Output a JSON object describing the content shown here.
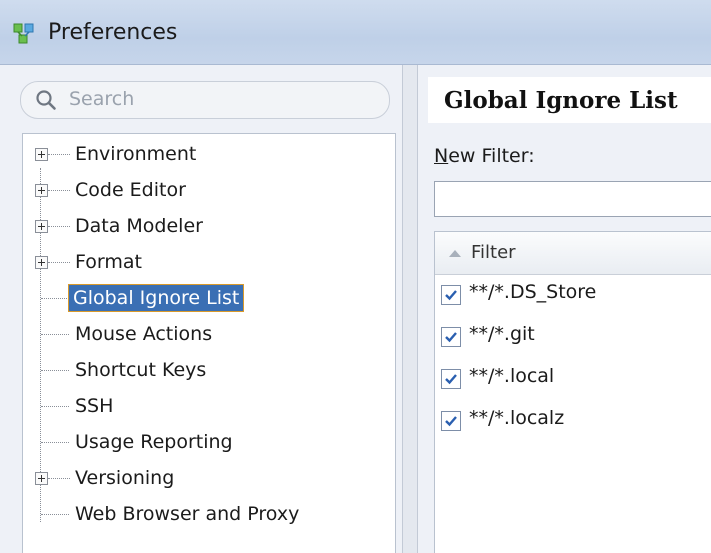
{
  "window": {
    "title": "Preferences",
    "icon": "preferences-app-icon"
  },
  "left_panel": {
    "search": {
      "placeholder": "Search",
      "value": ""
    },
    "tree": [
      {
        "label": "Environment",
        "expandable": true
      },
      {
        "label": "Code Editor",
        "expandable": true
      },
      {
        "label": "Data Modeler",
        "expandable": true
      },
      {
        "label": "Format",
        "expandable": true
      },
      {
        "label": "Global Ignore List",
        "expandable": false,
        "selected": true
      },
      {
        "label": "Mouse Actions",
        "expandable": false
      },
      {
        "label": "Shortcut Keys",
        "expandable": false
      },
      {
        "label": "SSH",
        "expandable": false
      },
      {
        "label": "Usage Reporting",
        "expandable": false
      },
      {
        "label": "Versioning",
        "expandable": true
      },
      {
        "label": "Web Browser and Proxy",
        "expandable": false
      }
    ]
  },
  "right_panel": {
    "page_title": "Global Ignore List",
    "new_filter_label_mnemonic": "N",
    "new_filter_label_rest": "ew Filter:",
    "new_filter_value": "",
    "table": {
      "column_header": "Filter",
      "rows": [
        {
          "pattern": "**/*.DS_Store",
          "checked": true
        },
        {
          "pattern": "**/*.git",
          "checked": true
        },
        {
          "pattern": "**/*.local",
          "checked": true
        },
        {
          "pattern": "**/*.localz",
          "checked": true
        }
      ]
    }
  },
  "colors": {
    "selection": "#3a6fb4",
    "selection_focus": "#d99a2b",
    "titlebar": "#c6d5ea"
  }
}
